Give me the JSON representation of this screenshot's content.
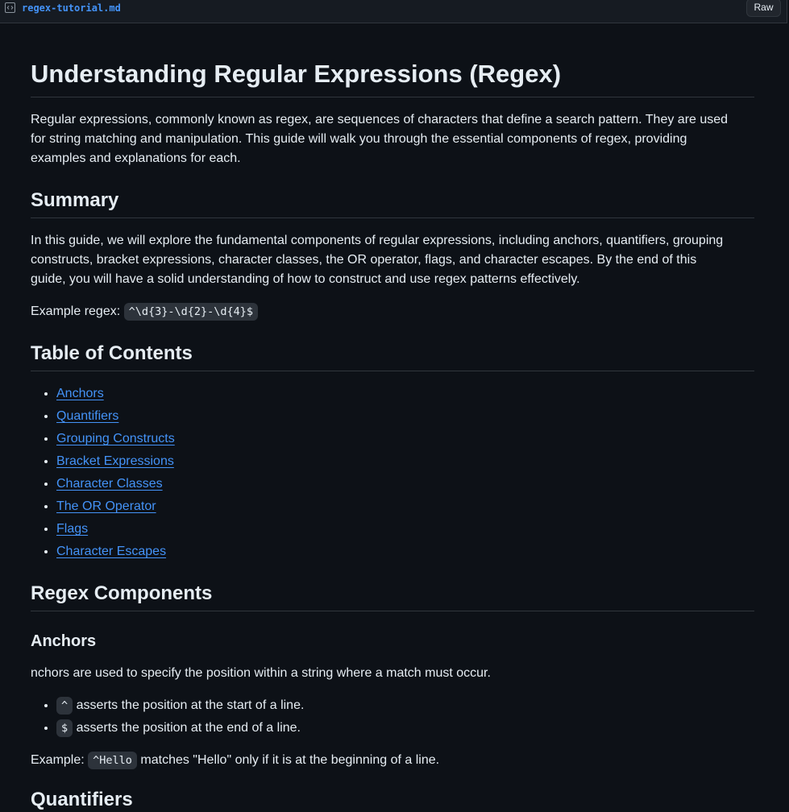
{
  "header": {
    "file_name": "regex-tutorial.md",
    "raw_label": "Raw"
  },
  "doc": {
    "title": "Understanding Regular Expressions (Regex)",
    "intro_lines": [
      "Regular expressions, commonly known as regex, are sequences of characters that define a search pattern. They are used",
      "for string matching and manipulation. This guide will walk you through the essential components of regex, providing",
      "examples and explanations for each."
    ],
    "summary_heading": "Summary",
    "summary_lines": [
      "In this guide, we will explore the fundamental components of regular expressions, including anchors, quantifiers, grouping",
      "constructs, bracket expressions, character classes, the OR operator, flags, and character escapes. By the end of this",
      "guide, you will have a solid understanding of how to construct and use regex patterns effectively."
    ],
    "example_label": "Example regex:",
    "example_code": "^\\d{3}-\\d{2}-\\d{4}$",
    "toc_heading": "Table of Contents",
    "toc_items": [
      "Anchors",
      "Quantifiers",
      "Grouping Constructs",
      "Bracket Expressions",
      "Character Classes",
      "The OR Operator",
      "Flags",
      "Character Escapes"
    ],
    "components_heading": "Regex Components",
    "anchors_heading": "Anchors",
    "anchors_text": "nchors are used to specify the position within a string where a match must occur.",
    "anchor_items": [
      {
        "code": "^",
        "text": "asserts the position at the start of a line."
      },
      {
        "code": "$",
        "text": "asserts the position at the end of a line."
      }
    ],
    "anchors_example_label": "Example:",
    "anchors_example_code": "^Hello",
    "anchors_example_text": "matches \"Hello\" only if it is at the beginning of a line.",
    "quantifiers_heading": "Quantifiers"
  },
  "colors": {
    "background": "#0d1117",
    "link": "#4493f8",
    "text": "#e6edf3",
    "border": "#30363d"
  }
}
